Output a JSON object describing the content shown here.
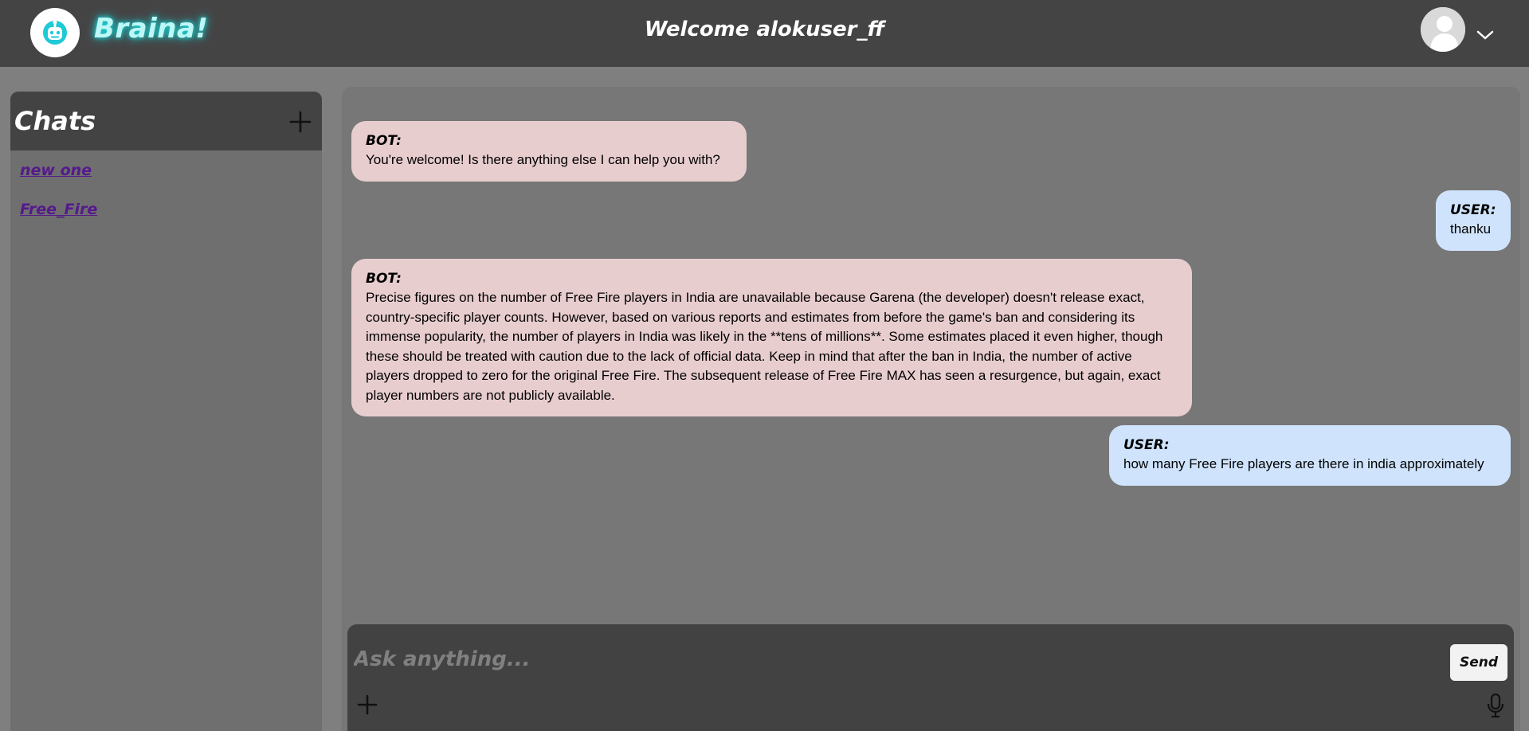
{
  "header": {
    "brand": "Braina!",
    "welcome": "Welcome alokuser_ff",
    "icons": {
      "logo": "robot-logo-icon",
      "avatar": "user-avatar-icon",
      "menu": "chevron-down-icon"
    },
    "colors": {
      "bar": "#454445",
      "brand_glow": "#18d9d9"
    }
  },
  "sidebar": {
    "title": "Chats",
    "new_chat_icon": "plus-icon",
    "chats": [
      {
        "label": "new one"
      },
      {
        "label": "Free_Fire"
      }
    ]
  },
  "messages": [
    {
      "role": "bot",
      "sender": "BOT:",
      "text": "You're welcome! Is there anything else I can help you with?"
    },
    {
      "role": "user",
      "sender": "USER:",
      "text": "thanku"
    },
    {
      "role": "bot",
      "sender": "BOT:",
      "text": "Precise figures on the number of Free Fire players in India are unavailable because Garena (the developer) doesn't release exact, country-specific player counts. However, based on various reports and estimates from before the game's ban and considering its immense popularity, the number of players in India was likely in the **tens of millions**. Some estimates placed it even higher, though these should be treated with caution due to the lack of official data. Keep in mind that after the ban in India, the number of active players dropped to zero for the original Free Fire. The subsequent release of Free Fire MAX has seen a resurgence, but again, exact player numbers are not publicly available."
    },
    {
      "role": "user",
      "sender": "USER:",
      "text": "how many Free Fire players are there in india approximately"
    }
  ],
  "composer": {
    "placeholder": "Ask anything...",
    "value": "",
    "send_label": "Send",
    "icons": {
      "attach": "plus-icon",
      "mic": "microphone-icon"
    }
  },
  "colors": {
    "bot_bubble": "#e8cdcf",
    "user_bubble": "#cfe3fc",
    "link": "#551a8b"
  }
}
